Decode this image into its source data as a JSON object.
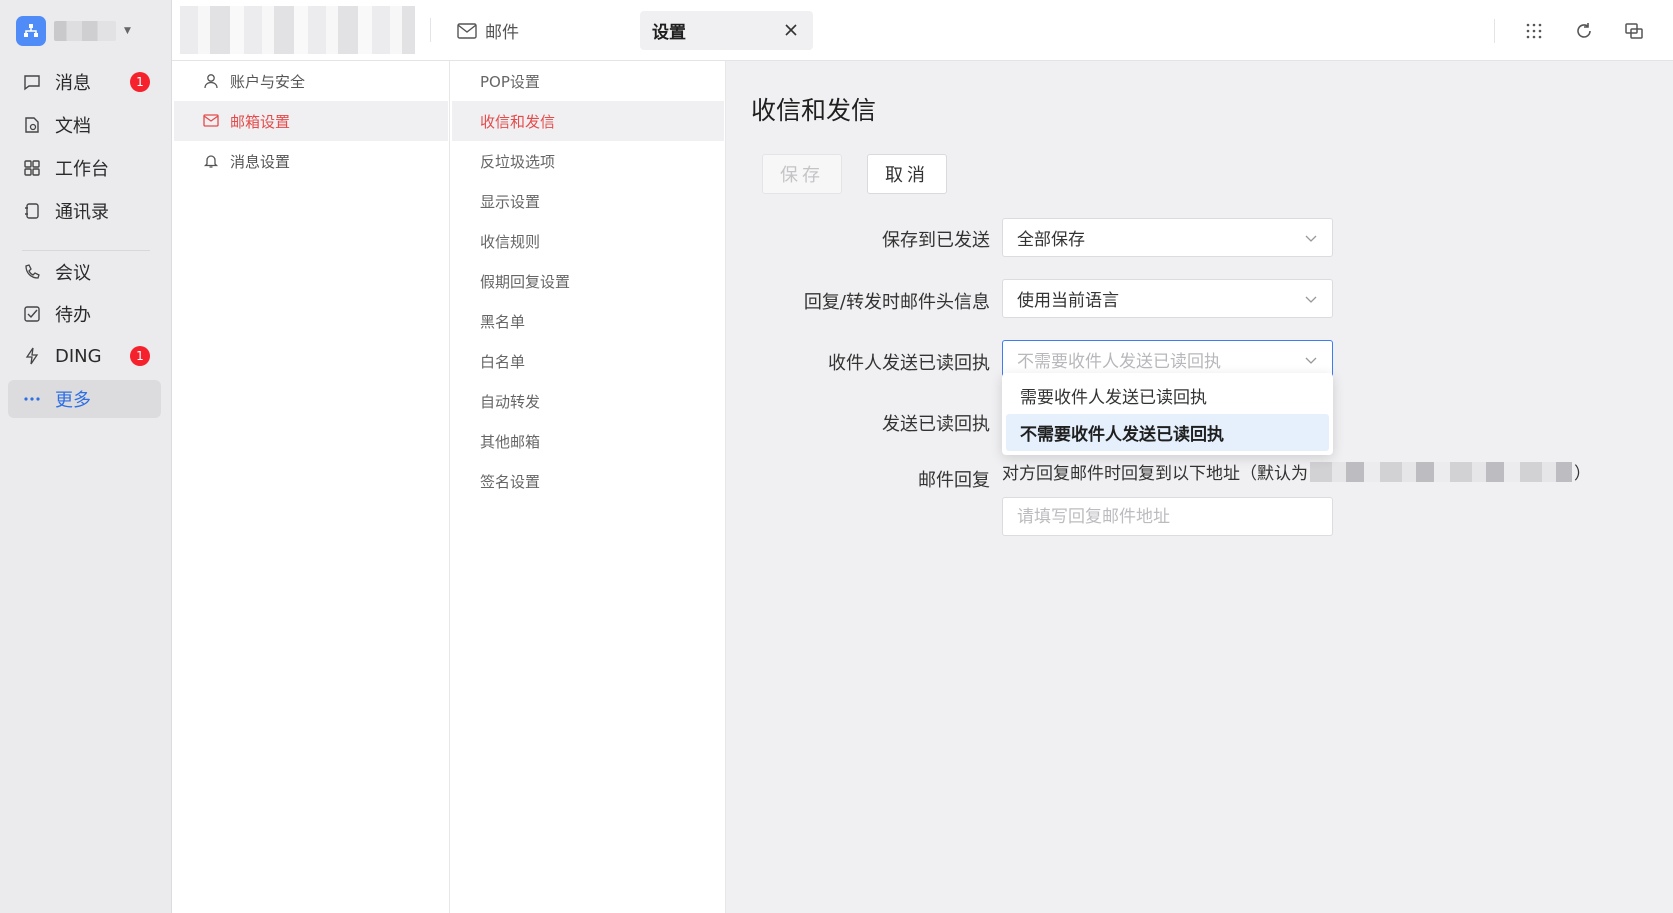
{
  "rail": {
    "items": [
      {
        "label": "消息",
        "icon": "message-icon",
        "badge": "1"
      },
      {
        "label": "文档",
        "icon": "document-icon"
      },
      {
        "label": "工作台",
        "icon": "workbench-icon"
      },
      {
        "label": "通讯录",
        "icon": "contacts-icon"
      },
      {
        "label": "会议",
        "icon": "meeting-icon"
      },
      {
        "label": "待办",
        "icon": "todo-icon"
      },
      {
        "label": "DING",
        "icon": "ding-icon",
        "badge": "1"
      },
      {
        "label": "更多",
        "icon": "more-icon",
        "active": true
      }
    ],
    "accent": "#2f6fe4",
    "badge_color": "#f5222d"
  },
  "tabs": {
    "mail": "邮件",
    "settings": "设置"
  },
  "settings_nav": {
    "items": [
      {
        "label": "账户与安全",
        "icon": "user-icon"
      },
      {
        "label": "邮箱设置",
        "icon": "mail-settings-icon",
        "active": true
      },
      {
        "label": "消息设置",
        "icon": "bell-icon"
      }
    ],
    "active_color": "#e54b4b"
  },
  "mail_nav": {
    "items": [
      "POP设置",
      "收信和发信",
      "反垃圾选项",
      "显示设置",
      "收信规则",
      "假期回复设置",
      "黑名单",
      "白名单",
      "自动转发",
      "其他邮箱",
      "签名设置"
    ],
    "active_index": 1
  },
  "main": {
    "title": "收信和发信",
    "save_label": "保存",
    "cancel_label": "取消",
    "fields": {
      "save_to_sent": {
        "label": "保存到已发送",
        "value": "全部保存"
      },
      "reply_header": {
        "label": "回复/转发时邮件头信息",
        "value": "使用当前语言"
      },
      "recipient_receipt": {
        "label": "收件人发送已读回执",
        "value": "不需要收件人发送已读回执"
      },
      "send_receipt": {
        "label": "发送已读回执"
      },
      "reply_to": {
        "label": "邮件回复",
        "hint_prefix": "对方回复邮件时回复到以下地址（默认为",
        "hint_suffix": "）",
        "placeholder": "请填写回复邮件地址"
      }
    },
    "dropdown_options": [
      {
        "label": "需要收件人发送已读回执"
      },
      {
        "label": "不需要收件人发送已读回执",
        "selected": true
      }
    ],
    "focus_color": "#3d7cf2"
  }
}
